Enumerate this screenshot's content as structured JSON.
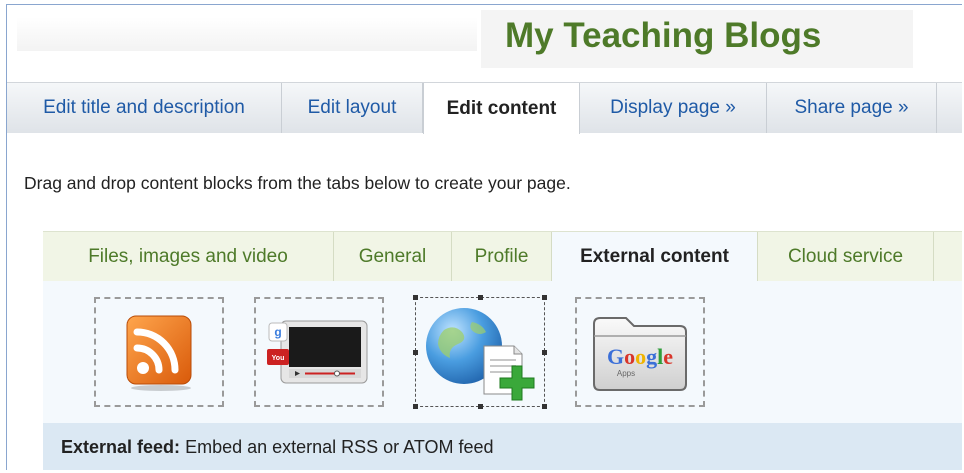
{
  "header": {
    "title": "My Teaching Blogs"
  },
  "page_tabs": [
    {
      "label": "Edit title and description",
      "active": false
    },
    {
      "label": "Edit layout",
      "active": false
    },
    {
      "label": "Edit content",
      "active": true
    },
    {
      "label": "Display page »",
      "active": false
    },
    {
      "label": "Share page »",
      "active": false
    }
  ],
  "instructions": "Drag and drop content blocks from the tabs below to create your page.",
  "block_tabs": [
    {
      "label": "Files, images and video",
      "active": false
    },
    {
      "label": "General",
      "active": false
    },
    {
      "label": "Profile",
      "active": false
    },
    {
      "label": "External content",
      "active": true
    },
    {
      "label": "Cloud service",
      "active": false
    }
  ],
  "blocks": [
    {
      "icon": "rss-feed-icon",
      "selected": false
    },
    {
      "icon": "external-video-icon",
      "selected": false
    },
    {
      "icon": "globe-add-page-icon",
      "selected": true
    },
    {
      "icon": "google-apps-folder-icon",
      "selected": false,
      "logo_text": "Google",
      "logo_subtext": "Apps"
    }
  ],
  "description": {
    "label": "External feed:",
    "text": "Embed an external RSS or ATOM feed"
  },
  "colors": {
    "title": "#4e7a29",
    "link": "#1f5aa6",
    "block_tab_text": "#4e7a29",
    "rss": "#f47a1f",
    "plus": "#3aa83a"
  }
}
